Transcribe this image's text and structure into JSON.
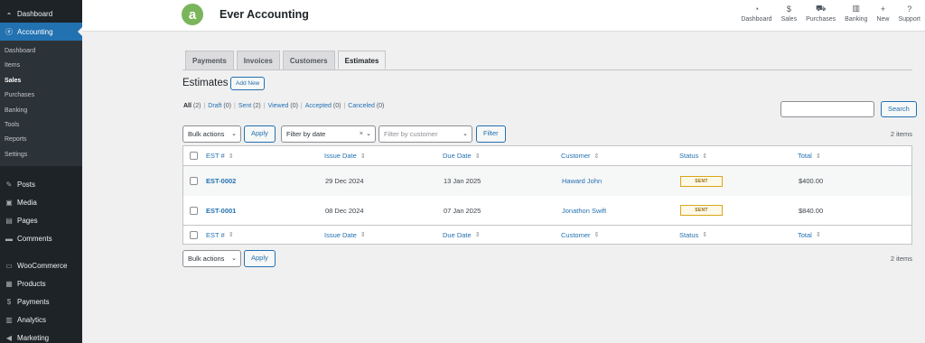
{
  "sidebar": {
    "top": [
      {
        "label": "Dashboard",
        "icon": "dashboard-icon",
        "glyph": "◓"
      },
      {
        "label": "Accounting",
        "icon": "accounting-icon",
        "glyph": "ⓔ"
      }
    ],
    "submenu": [
      "Dashboard",
      "Items",
      "Sales",
      "Purchases",
      "Banking",
      "Tools",
      "Reports",
      "Settings"
    ],
    "bottom": [
      {
        "label": "Posts",
        "icon": "pin-icon",
        "glyph": "✎"
      },
      {
        "label": "Media",
        "icon": "media-icon",
        "glyph": "▣"
      },
      {
        "label": "Pages",
        "icon": "pages-icon",
        "glyph": "▤"
      },
      {
        "label": "Comments",
        "icon": "comments-icon",
        "glyph": "▬"
      },
      {
        "label": "WooCommerce",
        "icon": "woocommerce-icon",
        "glyph": "▭"
      },
      {
        "label": "Products",
        "icon": "products-icon",
        "glyph": "▦"
      },
      {
        "label": "Payments",
        "icon": "payments-icon",
        "glyph": "$"
      },
      {
        "label": "Analytics",
        "icon": "analytics-icon",
        "glyph": "▥"
      },
      {
        "label": "Marketing",
        "icon": "megaphone-icon",
        "glyph": "◀"
      }
    ]
  },
  "header": {
    "logo_letter": "a",
    "title": "Ever Accounting",
    "nav": [
      {
        "label": "Dashboard",
        "icon": "gauge-icon",
        "glyph": "◔"
      },
      {
        "label": "Sales",
        "icon": "dollar-icon",
        "glyph": "$"
      },
      {
        "label": "Purchases",
        "icon": "cart-icon",
        "glyph": "⛟"
      },
      {
        "label": "Banking",
        "icon": "bank-icon",
        "glyph": "▥"
      },
      {
        "label": "New",
        "icon": "plus-icon",
        "glyph": "+"
      },
      {
        "label": "Support",
        "icon": "help-icon",
        "glyph": "?"
      }
    ]
  },
  "tabs": [
    "Payments",
    "Invoices",
    "Customers",
    "Estimates"
  ],
  "page": {
    "title": "Estimates",
    "add_new": "Add New"
  },
  "filters_links": {
    "all": "All",
    "all_count": "(2)",
    "draft": "Draft",
    "draft_count": "(0)",
    "sent": "Sent",
    "sent_count": "(2)",
    "viewed": "Viewed",
    "viewed_count": "(0)",
    "accepted": "Accepted",
    "accepted_count": "(0)",
    "canceled": "Canceled",
    "canceled_count": "(0)"
  },
  "search": {
    "placeholder": "",
    "button": "Search"
  },
  "toolbar": {
    "bulk_actions": "Bulk actions",
    "apply": "Apply",
    "filter_by_date": "Filter by date",
    "filter_by_customer": "Filter by customer",
    "filter": "Filter",
    "items": "2 items"
  },
  "table": {
    "columns": [
      "EST #",
      "Issue Date",
      "Due Date",
      "Customer",
      "Status",
      "Total"
    ],
    "rows": [
      {
        "number": "EST-0002",
        "issue_date": "29 Dec 2024",
        "due_date": "13 Jan 2025",
        "customer": "Haward John",
        "status": "SENT",
        "total": "$400.00"
      },
      {
        "number": "EST-0001",
        "issue_date": "08 Dec 2024",
        "due_date": "07 Jan 2025",
        "customer": "Jonathon Swift",
        "status": "SENT",
        "total": "$840.00"
      }
    ]
  },
  "colors": {
    "sidebar_bg": "#1d2327",
    "accent": "#2271b1",
    "logo": "#7ab55c",
    "badge_border": "#dba617"
  }
}
